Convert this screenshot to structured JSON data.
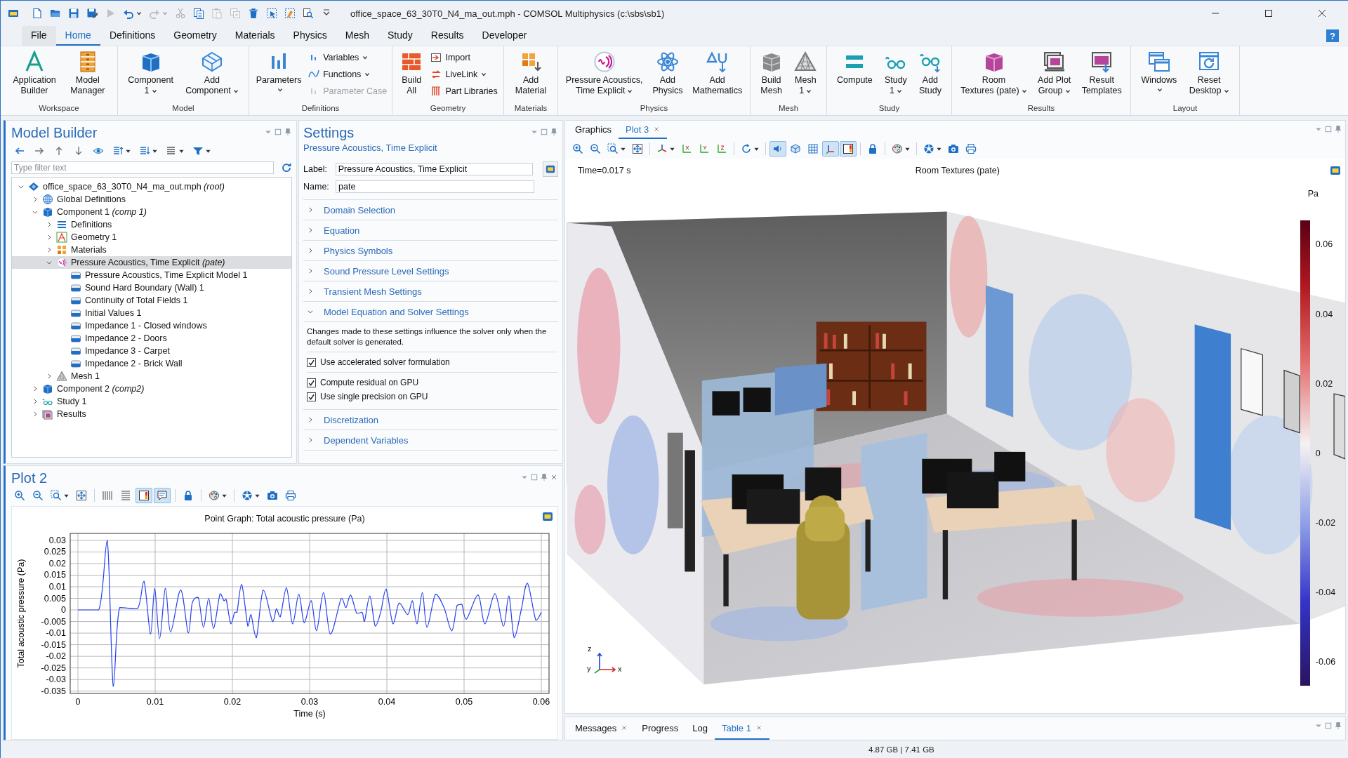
{
  "window": {
    "title": "office_space_63_30T0_N4_ma_out.mph - COMSOL Multiphysics (c:\\sbs\\sb1)"
  },
  "quick_access": [
    {
      "disabled": false
    },
    {
      "disabled": false
    },
    {
      "disabled": false
    },
    {
      "disabled": false
    },
    {
      "disabled": true
    },
    {
      "disabled": false
    },
    {
      "disabled": true
    },
    {
      "disabled": true
    },
    {
      "disabled": false
    },
    {
      "disabled": true
    },
    {
      "disabled": true
    },
    {
      "disabled": false
    },
    {
      "disabled": false
    },
    {
      "disabled": false
    },
    {
      "disabled": false
    },
    {
      "disabled": false
    }
  ],
  "menu_tabs": [
    {
      "label": "File",
      "kind": "file",
      "selected": false
    },
    {
      "label": "Home",
      "kind": "tab",
      "selected": true
    },
    {
      "label": "Definitions",
      "kind": "tab",
      "selected": false
    },
    {
      "label": "Geometry",
      "kind": "tab",
      "selected": false
    },
    {
      "label": "Materials",
      "kind": "tab",
      "selected": false
    },
    {
      "label": "Physics",
      "kind": "tab",
      "selected": false
    },
    {
      "label": "Mesh",
      "kind": "tab",
      "selected": false
    },
    {
      "label": "Study",
      "kind": "tab",
      "selected": false
    },
    {
      "label": "Results",
      "kind": "tab",
      "selected": false
    },
    {
      "label": "Developer",
      "kind": "tab",
      "selected": false
    }
  ],
  "help": "?",
  "ribbon": {
    "groups": [
      {
        "title": "Workspace",
        "buttons": [
          {
            "kind": "large",
            "lines": [
              "Application",
              "Builder"
            ],
            "dropdown": false,
            "disabled": false
          },
          {
            "kind": "large",
            "lines": [
              "Model",
              "Manager"
            ],
            "dropdown": false,
            "disabled": false
          }
        ]
      },
      {
        "title": "Model",
        "buttons": [
          {
            "kind": "large",
            "lines": [
              "Component",
              "1"
            ],
            "dropdown": true,
            "disabled": false
          },
          {
            "kind": "large",
            "lines": [
              "Add",
              "Component"
            ],
            "dropdown": true,
            "disabled": false
          }
        ]
      },
      {
        "title": "Definitions",
        "buttons": [
          {
            "kind": "tall",
            "lines": [
              "Parameters"
            ],
            "dropdown": true,
            "disabled": false
          },
          {
            "kind": "small",
            "lines": [
              "Variables"
            ],
            "dropdown": true,
            "disabled": false
          },
          {
            "kind": "small",
            "lines": [
              "Functions"
            ],
            "dropdown": true,
            "disabled": false
          },
          {
            "kind": "small",
            "lines": [
              "Parameter Case"
            ],
            "dropdown": false,
            "disabled": true
          }
        ]
      },
      {
        "title": "Geometry",
        "buttons": [
          {
            "kind": "large",
            "lines": [
              "Build",
              "All"
            ],
            "dropdown": false,
            "disabled": false
          },
          {
            "kind": "small",
            "lines": [
              "Import"
            ],
            "dropdown": false,
            "disabled": false
          },
          {
            "kind": "small",
            "lines": [
              "LiveLink"
            ],
            "dropdown": true,
            "disabled": false
          },
          {
            "kind": "small",
            "lines": [
              "Part Libraries"
            ],
            "dropdown": false,
            "disabled": false
          }
        ]
      },
      {
        "title": "Materials",
        "buttons": [
          {
            "kind": "large",
            "lines": [
              "Add",
              "Material"
            ],
            "dropdown": false,
            "disabled": false
          }
        ]
      },
      {
        "title": "Physics",
        "buttons": [
          {
            "kind": "large",
            "lines": [
              "Pressure Acoustics,",
              "Time Explicit"
            ],
            "dropdown": true,
            "disabled": false
          },
          {
            "kind": "large",
            "lines": [
              "Add",
              "Physics"
            ],
            "dropdown": false,
            "disabled": false
          },
          {
            "kind": "large",
            "lines": [
              "Add",
              "Mathematics"
            ],
            "dropdown": false,
            "disabled": false
          }
        ]
      },
      {
        "title": "Mesh",
        "buttons": [
          {
            "kind": "large",
            "lines": [
              "Build",
              "Mesh"
            ],
            "dropdown": false,
            "disabled": false
          },
          {
            "kind": "large",
            "lines": [
              "Mesh",
              "1"
            ],
            "dropdown": true,
            "disabled": false
          }
        ]
      },
      {
        "title": "Study",
        "buttons": [
          {
            "kind": "large",
            "lines": [
              "Compute"
            ],
            "dropdown": false,
            "disabled": false
          },
          {
            "kind": "large",
            "lines": [
              "Study",
              "1"
            ],
            "dropdown": true,
            "disabled": false
          },
          {
            "kind": "large",
            "lines": [
              "Add",
              "Study"
            ],
            "dropdown": false,
            "disabled": false
          }
        ]
      },
      {
        "title": "Results",
        "buttons": [
          {
            "kind": "large",
            "lines": [
              "Room",
              "Textures (pate)"
            ],
            "dropdown": true,
            "disabled": false
          },
          {
            "kind": "large",
            "lines": [
              "Add Plot",
              "Group"
            ],
            "dropdown": true,
            "disabled": false
          },
          {
            "kind": "large",
            "lines": [
              "Result",
              "Templates"
            ],
            "dropdown": false,
            "disabled": false
          }
        ]
      },
      {
        "title": "Layout",
        "buttons": [
          {
            "kind": "tall",
            "lines": [
              "Windows"
            ],
            "dropdown": true,
            "disabled": false
          },
          {
            "kind": "large",
            "lines": [
              "Reset",
              "Desktop"
            ],
            "dropdown": true,
            "disabled": false
          }
        ]
      }
    ]
  },
  "model_builder": {
    "title": "Model Builder",
    "filter": {
      "placeholder": "Type filter text"
    },
    "tree": [
      {
        "label": "office_space_63_30T0_N4_ma_out.mph *(root)*",
        "kind": "folder",
        "expanded": true,
        "selected": false,
        "children": [
          {
            "label": "Global Definitions",
            "kind": "folder",
            "expanded": false,
            "selected": false
          },
          {
            "label": "Component 1 *(comp 1)*",
            "kind": "folder",
            "expanded": true,
            "selected": false,
            "children": [
              {
                "label": "Definitions",
                "kind": "folder",
                "expanded": false,
                "selected": false
              },
              {
                "label": "Geometry 1",
                "kind": "folder",
                "expanded": false,
                "selected": false
              },
              {
                "label": "Materials",
                "kind": "folder",
                "expanded": false,
                "selected": false
              },
              {
                "label": "Pressure Acoustics, Time Explicit *(pate)*",
                "kind": "folder",
                "expanded": true,
                "selected": true,
                "children": [
                  {
                    "label": "Pressure Acoustics, Time Explicit Model 1",
                    "kind": "leaf",
                    "selected": false
                  },
                  {
                    "label": "Sound Hard Boundary (Wall) 1",
                    "kind": "leaf",
                    "selected": false
                  },
                  {
                    "label": "Continuity of Total Fields 1",
                    "kind": "leaf",
                    "selected": false
                  },
                  {
                    "label": "Initial Values 1",
                    "kind": "leaf",
                    "selected": false
                  },
                  {
                    "label": "Impedance 1 - Closed windows",
                    "kind": "leaf",
                    "selected": false
                  },
                  {
                    "label": "Impedance 2 - Doors",
                    "kind": "leaf",
                    "selected": false
                  },
                  {
                    "label": "Impedance 3 - Carpet",
                    "kind": "leaf",
                    "selected": false
                  },
                  {
                    "label": "Impedance 2 - Brick Wall",
                    "kind": "leaf",
                    "selected": false
                  }
                ]
              },
              {
                "label": "Mesh 1",
                "kind": "folder",
                "expanded": false,
                "selected": false
              }
            ]
          },
          {
            "label": "Component 2 *(comp2)*",
            "kind": "folder",
            "expanded": false,
            "selected": false
          },
          {
            "label": "Study 1",
            "kind": "folder",
            "expanded": false,
            "selected": false
          },
          {
            "label": "Results",
            "kind": "folder",
            "expanded": false,
            "selected": false
          }
        ]
      }
    ]
  },
  "settings": {
    "title": "Settings",
    "subtitle": "Pressure Acoustics, Time Explicit",
    "fields": [
      {
        "label": "Label:",
        "value": "Pressure Acoustics, Time Explicit"
      },
      {
        "label": "Name:",
        "value": "pate"
      }
    ],
    "sections": [
      {
        "title": "Domain Selection",
        "expanded": false
      },
      {
        "title": "Equation",
        "expanded": false
      },
      {
        "title": "Physics Symbols",
        "expanded": false
      },
      {
        "title": "Sound Pressure Level Settings",
        "expanded": false
      },
      {
        "title": "Transient Mesh Settings",
        "expanded": false
      },
      {
        "title": "Model Equation and Solver Settings",
        "expanded": true,
        "description": "Changes made to these settings influence the solver only when the default solver is generated.",
        "checkbox_groups": [
          [
            {
              "label": "Use accelerated solver formulation",
              "checked": true
            }
          ],
          [
            {
              "label": "Compute residual on GPU",
              "checked": true
            },
            {
              "label": "Use single precision on GPU",
              "checked": true
            }
          ]
        ]
      },
      {
        "title": "Discretization",
        "expanded": false
      },
      {
        "title": "Dependent Variables",
        "expanded": false
      }
    ]
  },
  "plot2": {
    "title": "Plot 2",
    "toolbar": [
      {
        "pressed": false
      },
      {
        "pressed": false
      },
      {
        "pressed": false
      },
      {
        "pressed": false
      },
      {
        "pressed": false
      },
      {
        "pressed": false
      },
      {
        "pressed": true
      },
      {
        "pressed": true
      },
      {
        "pressed": false
      },
      {
        "pressed": false
      },
      {
        "pressed": false
      },
      {
        "pressed": false
      },
      {
        "pressed": false
      }
    ],
    "chart_data": {
      "type": "line",
      "grid": true,
      "title": "Point Graph: Total acoustic pressure (Pa)",
      "xlabel": "Time (s)",
      "ylabel": "Total acoustic pressure (Pa)",
      "x": [
        0,
        0.0027,
        0.0038,
        0.00457,
        0.0054,
        0.0077,
        0.00855,
        0.0094,
        0.00994,
        0.01057,
        0.01133,
        0.012,
        0.0133,
        0.01429,
        0.0148,
        0.01558,
        0.01626,
        0.01693,
        0.01755,
        0.0184,
        0.0189,
        0.0192,
        0.0198,
        0.0203,
        0.0206,
        0.0212,
        0.022,
        0.0224,
        0.0231,
        0.024,
        0.0252,
        0.0257,
        0.0262,
        0.027,
        0.0278,
        0.0286,
        0.0293,
        0.0302,
        0.0309,
        0.0318,
        0.0327,
        0.0341,
        0.0347,
        0.0353,
        0.0361,
        0.0368,
        0.0371,
        0.0378,
        0.0385,
        0.0392,
        0.0399,
        0.0408,
        0.0416,
        0.0427,
        0.0433,
        0.0439,
        0.0446,
        0.0452,
        0.0463,
        0.0474,
        0.0484,
        0.0491,
        0.0497,
        0.0503,
        0.0518,
        0.0527,
        0.054,
        0.0551,
        0.0558,
        0.0565,
        0.0574,
        0.0582,
        0.0593,
        0.06
      ],
      "values": [
        0,
        0,
        0.03,
        -0.033,
        0.001,
        0.0005,
        0.0124,
        -0.0104,
        0.0092,
        -0.0124,
        0.0094,
        -0.0095,
        0.0086,
        -0.0099,
        0.003,
        0.0054,
        -0.0075,
        0.005,
        -0.008,
        0.007,
        0.004,
        0.0045,
        -0.006,
        -0.001,
        -0.001,
        0.011,
        -0.007,
        -0.002,
        -0.012,
        0.0086,
        -0.005,
        0.0005,
        -0.003,
        0.0095,
        -0.006,
        0.0068,
        -0.0055,
        0.004,
        -0.009,
        0.0075,
        -0.0105,
        0.005,
        0.001,
        0.0065,
        -0.0015,
        -0.001,
        -0.005,
        0.006,
        -0.007,
        -0.001,
        0.009,
        -0.006,
        0.003,
        -0.002,
        0.004,
        -0.006,
        0.0075,
        -0.0075,
        0.0068,
        0.001,
        -0.009,
        0.002,
        0.0025,
        -0.004,
        0.0065,
        -0.006,
        0.007,
        -0.007,
        0.006,
        -0.012,
        0,
        0.0115,
        -0.0045,
        -0.001
      ],
      "xlim": [
        -0.001,
        0.061
      ],
      "ylim": [
        -0.036,
        0.033
      ],
      "xticks": [
        0,
        0.01,
        0.02,
        0.03,
        0.04,
        0.05,
        0.06
      ],
      "yticks": [
        0.03,
        0.025,
        0.02,
        0.015,
        0.01,
        0.005,
        0,
        -0.005,
        -0.01,
        -0.015,
        -0.02,
        -0.025,
        -0.03,
        -0.035
      ]
    }
  },
  "graphics": {
    "tabs": [
      {
        "label": "Graphics",
        "selected": false,
        "closable": false
      },
      {
        "label": "Plot 3",
        "selected": true,
        "closable": true
      }
    ],
    "toolbar": [
      {
        "pressed": false
      },
      {
        "pressed": false
      },
      {
        "pressed": false
      },
      {
        "pressed": false
      },
      {
        "pressed": false
      },
      {
        "pressed": false
      },
      {
        "pressed": false
      },
      {
        "pressed": false
      },
      {
        "pressed": false
      },
      {
        "pressed": true
      },
      {
        "pressed": false
      },
      {
        "pressed": false
      },
      {
        "pressed": true
      },
      {
        "pressed": true
      },
      {
        "pressed": false
      },
      {
        "pressed": false
      },
      {
        "pressed": false
      },
      {
        "pressed": false
      },
      {
        "pressed": false
      }
    ],
    "time": "Time=0.017 s",
    "title": "Room Textures (pate)",
    "colorbar": {
      "unit": "Pa",
      "ticks": [
        "0.06",
        "0.04",
        "0.02",
        "0",
        "-0.02",
        "-0.04",
        "-0.06"
      ]
    },
    "axes": {
      "z": "z",
      "y": "y",
      "x": "x"
    }
  },
  "bottom_tabs": [
    {
      "label": "Messages",
      "selected": false,
      "closable": true
    },
    {
      "label": "Progress",
      "selected": false,
      "closable": false
    },
    {
      "label": "Log",
      "selected": false,
      "closable": false
    },
    {
      "label": "Table 1",
      "selected": true,
      "closable": true
    }
  ],
  "status_bar": {
    "memory": "4.87 GB | 7.41 GB"
  }
}
